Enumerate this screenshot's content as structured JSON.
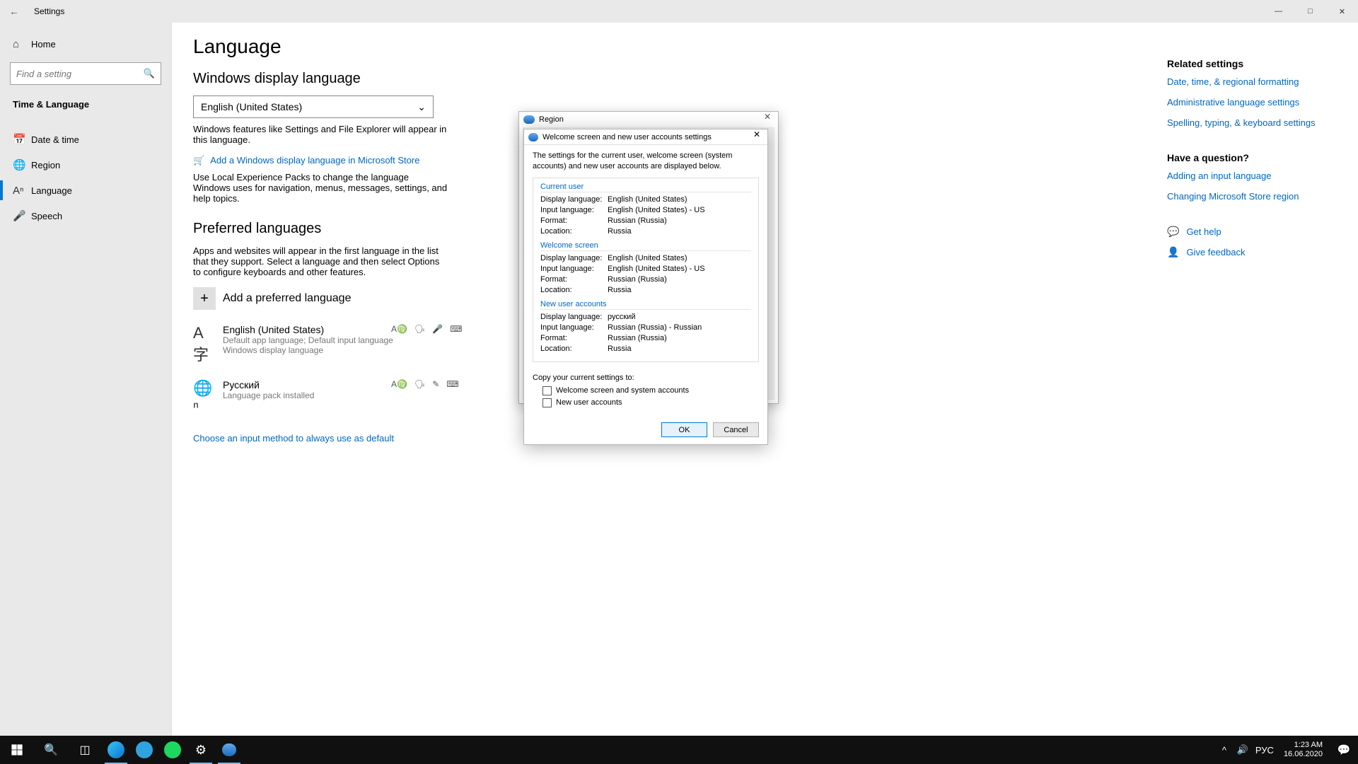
{
  "window": {
    "title": "Settings"
  },
  "sidebar": {
    "home": "Home",
    "search_placeholder": "Find a setting",
    "category": "Time & Language",
    "items": [
      {
        "label": "Date & time"
      },
      {
        "label": "Region"
      },
      {
        "label": "Language"
      },
      {
        "label": "Speech"
      }
    ]
  },
  "main": {
    "title": "Language",
    "display_section": "Windows display language",
    "display_select": "English (United States)",
    "display_desc": "Windows features like Settings and File Explorer will appear in this language.",
    "store_link": "Add a Windows display language in Microsoft Store",
    "lep_desc": "Use Local Experience Packs to change the language Windows uses for navigation, menus, messages, settings, and help topics.",
    "pref_section": "Preferred languages",
    "pref_desc": "Apps and websites will appear in the first language in the list that they support. Select a language and then select Options to configure keyboards and other features.",
    "add_pref": "Add a preferred language",
    "langs": [
      {
        "name": "English (United States)",
        "sub1": "Default app language; Default input language",
        "sub2": "Windows display language"
      },
      {
        "name": "Русский",
        "sub1": "Language pack installed",
        "sub2": ""
      }
    ],
    "default_link": "Choose an input method to always use as default"
  },
  "right": {
    "related_h": "Related settings",
    "related": [
      "Date, time, & regional formatting",
      "Administrative language settings",
      "Spelling, typing, & keyboard settings"
    ],
    "question_h": "Have a question?",
    "questions": [
      "Adding an input language",
      "Changing Microsoft Store region"
    ],
    "help": "Get help",
    "feedback": "Give feedback"
  },
  "region_dialog": {
    "title": "Region"
  },
  "dialog": {
    "title": "Welcome screen and new user accounts settings",
    "info": "The settings for the current user, welcome screen (system accounts) and new user accounts are displayed below.",
    "groups": [
      {
        "label": "Current user",
        "rows": [
          {
            "k": "Display language:",
            "v": "English (United States)"
          },
          {
            "k": "Input language:",
            "v": "English (United States) - US"
          },
          {
            "k": "Format:",
            "v": "Russian (Russia)"
          },
          {
            "k": "Location:",
            "v": "Russia"
          }
        ]
      },
      {
        "label": "Welcome screen",
        "rows": [
          {
            "k": "Display language:",
            "v": "English (United States)"
          },
          {
            "k": "Input language:",
            "v": "English (United States) - US"
          },
          {
            "k": "Format:",
            "v": "Russian (Russia)"
          },
          {
            "k": "Location:",
            "v": "Russia"
          }
        ]
      },
      {
        "label": "New user accounts",
        "rows": [
          {
            "k": "Display language:",
            "v": "русский"
          },
          {
            "k": "Input language:",
            "v": "Russian (Russia) - Russian"
          },
          {
            "k": "Format:",
            "v": "Russian (Russia)"
          },
          {
            "k": "Location:",
            "v": "Russia"
          }
        ]
      }
    ],
    "copy_label": "Copy your current settings to:",
    "cb1": "Welcome screen and system accounts",
    "cb2": "New user accounts",
    "ok": "OK",
    "cancel": "Cancel"
  },
  "taskbar": {
    "lang": "РУС",
    "time": "1:23 AM",
    "date": "16.06.2020"
  }
}
